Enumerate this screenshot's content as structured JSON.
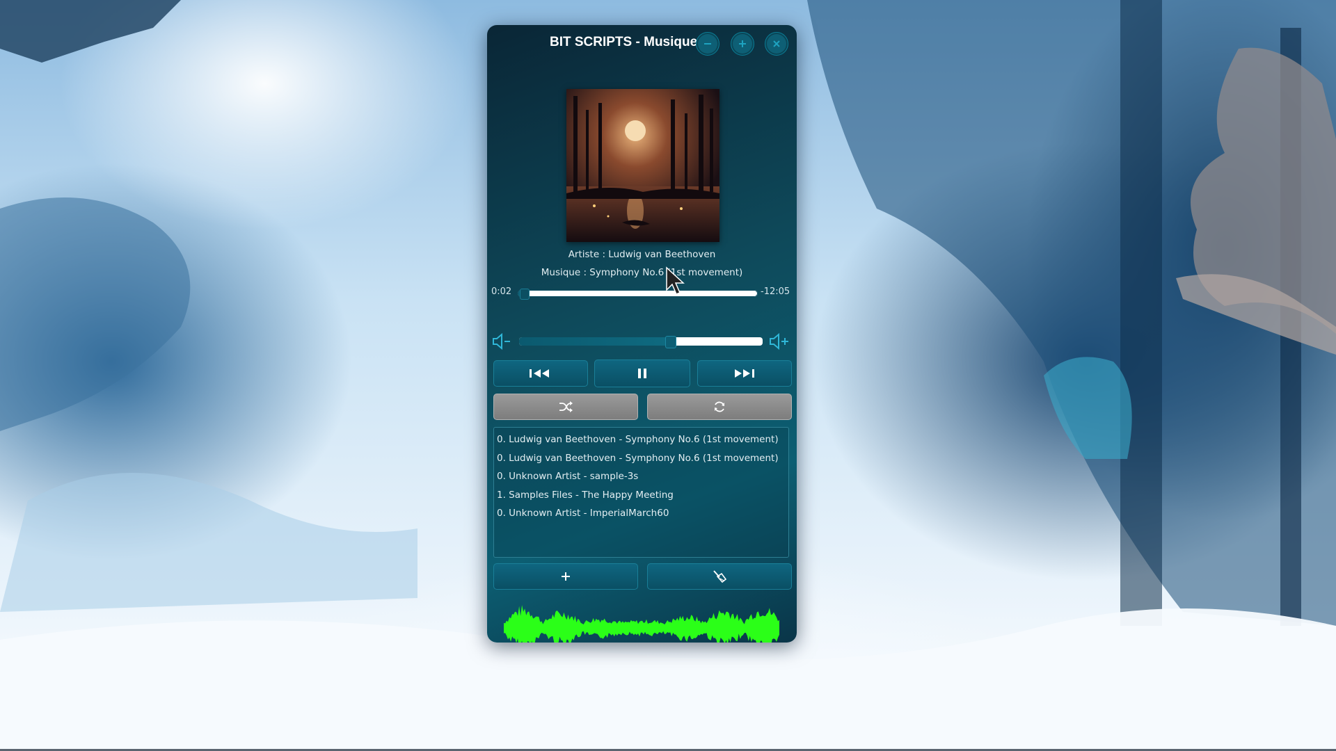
{
  "window": {
    "title": "BIT SCRIPTS - Musique"
  },
  "now_playing": {
    "artist_line": "Artiste : Ludwig van Beethoven",
    "track_line": "Musique : Symphony No.6 (1st movement)",
    "elapsed": "0:02",
    "remaining": "-12:05",
    "progress_fraction": 0.003,
    "volume_fraction": 0.61
  },
  "controls": {
    "prev_icon": "skip-previous-icon",
    "pause_icon": "pause-icon",
    "next_icon": "skip-next-icon",
    "shuffle_icon": "shuffle-icon",
    "repeat_icon": "repeat-icon",
    "add_icon": "plus-icon",
    "clear_icon": "broom-icon",
    "volume_down_icon": "volume-down-icon",
    "volume_up_icon": "volume-up-icon"
  },
  "playlist": [
    "0. Ludwig van Beethoven - Symphony No.6 (1st movement)",
    "0. Ludwig van Beethoven - Symphony No.6 (1st movement)",
    "0. Unknown Artist - sample-3s",
    "1. Samples Files - The Happy Meeting",
    "0. Unknown Artist - ImperialMarch60"
  ],
  "colors": {
    "accent": "#0c5b70",
    "waveform": "#2bff18"
  }
}
